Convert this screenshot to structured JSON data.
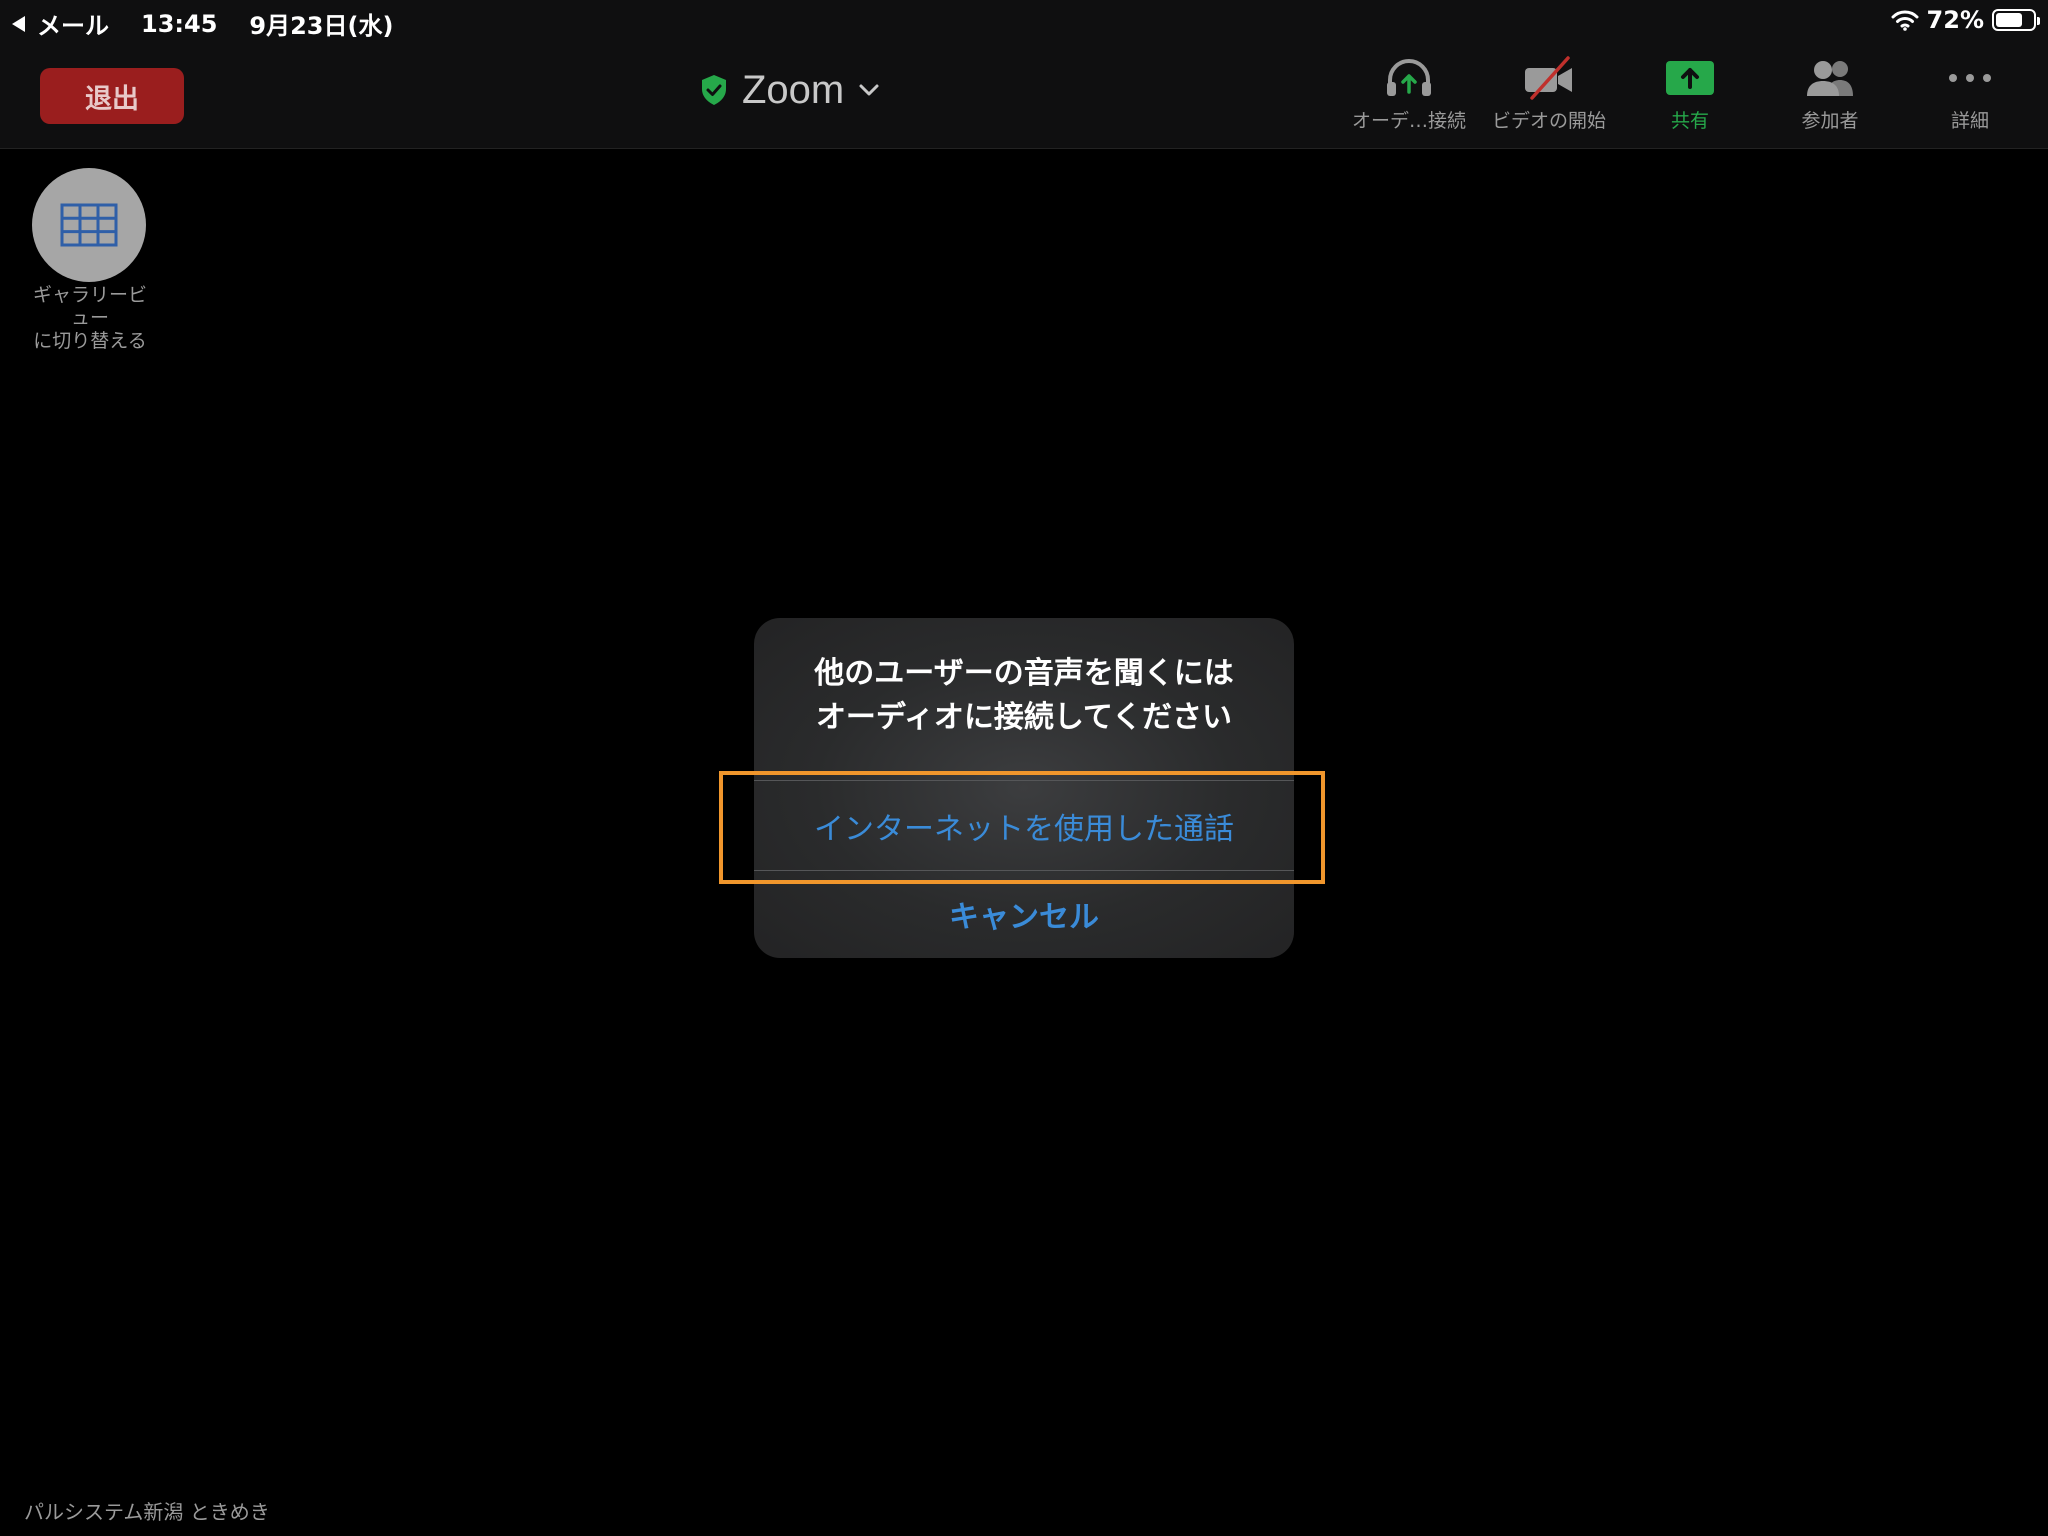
{
  "status_bar": {
    "back_app": "メール",
    "time": "13:45",
    "date": "9月23日(水)",
    "battery_percent": "72%",
    "battery_level": 0.72
  },
  "toolbar": {
    "leave_label": "退出",
    "meeting_title": "Zoom",
    "items": [
      {
        "label": "オーデ…接続",
        "icon": "headphones-icon"
      },
      {
        "label": "ビデオの開始",
        "icon": "video-off-icon"
      },
      {
        "label": "共有",
        "icon": "share-icon"
      },
      {
        "label": "参加者",
        "icon": "participants-icon"
      },
      {
        "label": "詳細",
        "icon": "more-icon"
      }
    ]
  },
  "gallery": {
    "label": "ギャラリービ\nュー\nに切り替える",
    "icon": "grid-icon"
  },
  "dialog": {
    "message_line1": "他のユーザーの音声を聞くには",
    "message_line2": "オーディオに接続してください",
    "primary_action": "インターネットを使用した通話",
    "cancel_action": "キャンセル"
  },
  "participant_name": "パルシステム新潟 ときめき",
  "colors": {
    "accent_blue": "#3a8bd8",
    "leave_red": "#9a1e1e",
    "share_green": "#26a84a",
    "highlight_orange": "#f0962c",
    "shield_green": "#26a84a"
  }
}
